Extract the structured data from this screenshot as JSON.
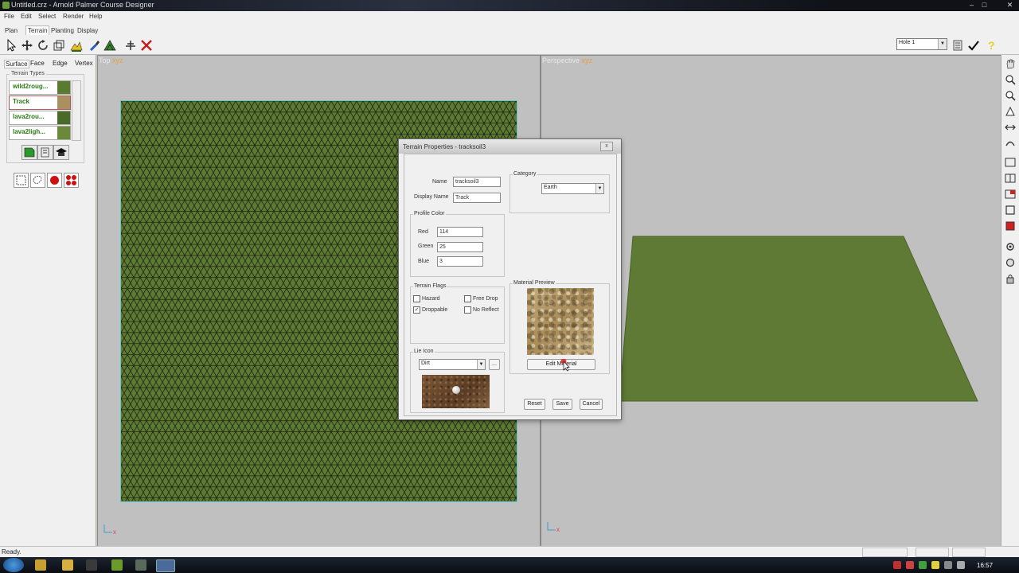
{
  "window": {
    "title": "Untitled.crz - Arnold Palmer Course Designer",
    "min": "–",
    "max": "□",
    "close": "✕"
  },
  "menu": [
    "File",
    "Edit",
    "Select",
    "Render",
    "Help"
  ],
  "modes": [
    "Plan",
    "Terrain",
    "Planting",
    "Display"
  ],
  "toolbar": {
    "hole_select": "Hole 1"
  },
  "left_panel": {
    "tabs": [
      "Surface",
      "Face",
      "Edge",
      "Vertex"
    ],
    "terrain_types_label": "Terrain Types",
    "terrain_types": [
      {
        "name": "wild2roug...",
        "swatch": "#5a7a30"
      },
      {
        "name": "Track",
        "swatch": "#a89060"
      },
      {
        "name": "lava2rou...",
        "swatch": "#4a6a2a"
      },
      {
        "name": "lava2ligh...",
        "swatch": "#6a8a3a"
      }
    ]
  },
  "viewports": {
    "top": {
      "label": "Top",
      "mode": "xyz",
      "axis": "x"
    },
    "perspective": {
      "label": "Perspective",
      "mode": "xyz",
      "axis": "x"
    }
  },
  "colors": {
    "terrain": "#5e7a34",
    "grid": "#1a2410",
    "grid_border": "#5ec9c9",
    "viewport_bg": "#c0c0c0"
  },
  "dialog": {
    "title": "Terrain Properties - tracksoil3",
    "close": "x",
    "name_label": "Name",
    "name_value": "tracksoil3",
    "display_name_label": "Display Name",
    "display_name_value": "Track",
    "category_label": "Category",
    "category_value": "Earth",
    "profile_color_label": "Profile Color",
    "red_label": "Red",
    "red_value": "114",
    "green_label": "Green",
    "green_value": "25",
    "blue_label": "Blue",
    "blue_value": "3",
    "flags_label": "Terrain Flags",
    "flags": [
      {
        "label": "Hazard",
        "checked": false
      },
      {
        "label": "Free Drop",
        "checked": false
      },
      {
        "label": "Droppable",
        "checked": true
      },
      {
        "label": "No Reflect",
        "checked": false
      }
    ],
    "material_preview_label": "Material Preview",
    "edit_material": "Edit Material",
    "lie_icon_label": "Lie Icon",
    "lie_icon_value": "Dirt",
    "browse": "...",
    "reset": "Reset",
    "save": "Save",
    "cancel": "Cancel"
  },
  "status": {
    "text": "Ready."
  },
  "taskbar": {
    "clock": "16:57"
  }
}
